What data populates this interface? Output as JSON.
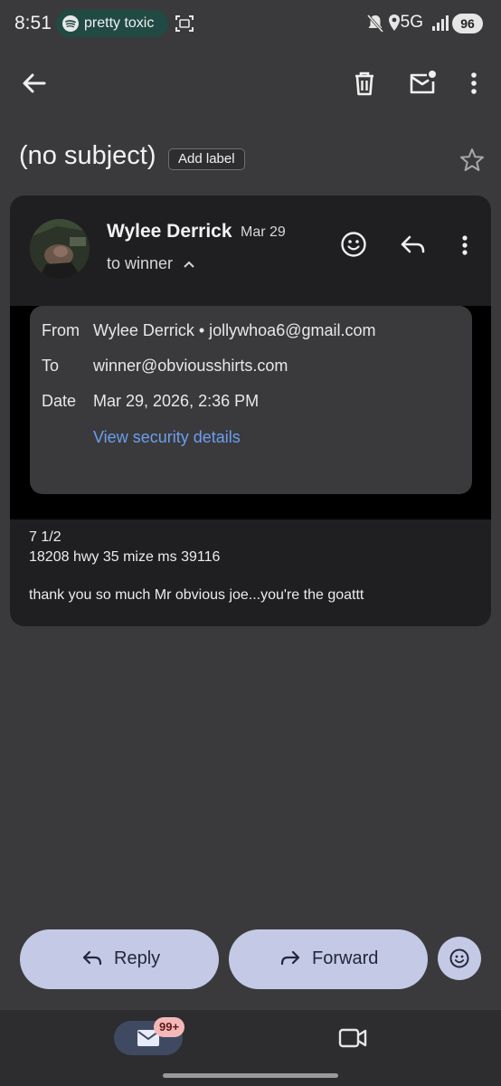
{
  "status_bar": {
    "time": "8:51",
    "now_playing": "pretty toxic",
    "network": "5G",
    "battery": "96"
  },
  "toolbar": {
    "back_icon": "arrow-back-icon",
    "delete_icon": "trash-icon",
    "mark_unread_icon": "mail-unread-icon",
    "more_icon": "more-vert-icon"
  },
  "subject": {
    "title": "(no subject)",
    "add_label": "Add label"
  },
  "message": {
    "sender_name": "Wylee Derrick",
    "date_short": "Mar 29",
    "recipient_summary": "to winner",
    "details": {
      "from_label": "From",
      "from_value": "Wylee Derrick • jollywhoa6@gmail.com",
      "to_label": "To",
      "to_value": "winner@obviousshirts.com",
      "date_label": "Date",
      "date_value": "Mar 29, 2026, 2:36 PM",
      "security_link": "View security details"
    },
    "body_lines": [
      "7 1/2",
      "18208 hwy 35 mize ms 39116",
      "thank you so much Mr obvious joe...you're the goattt"
    ]
  },
  "actions": {
    "reply": "Reply",
    "forward": "Forward"
  },
  "nav": {
    "mail_badge": "99+"
  },
  "colors": {
    "background": "#3a3a3c",
    "card": "#1f1f21",
    "link": "#6c9ef0",
    "pill_button": "#c4c9e6",
    "spotify_pill": "#214a44"
  }
}
